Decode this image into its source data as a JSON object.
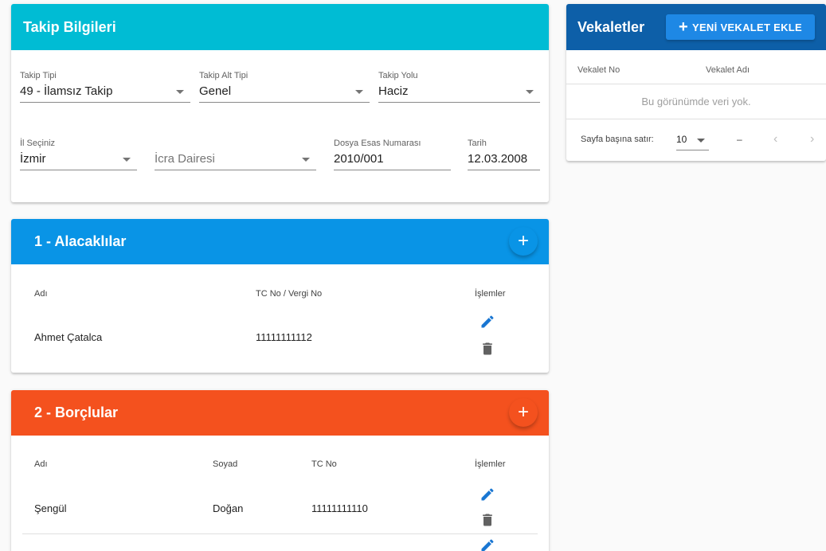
{
  "takip": {
    "title": "Takip Bilgileri",
    "takip_tipi": {
      "label": "Takip Tipi",
      "value": "49 - İlamsız Takip"
    },
    "takip_alt_tipi": {
      "label": "Takip Alt Tipi",
      "value": "Genel"
    },
    "takip_yolu": {
      "label": "Takip Yolu",
      "value": "Haciz"
    },
    "il": {
      "label": "İl Seçiniz",
      "value": "İzmir"
    },
    "icra_dairesi": {
      "placeholder": "İcra Dairesi"
    },
    "dosya_esas": {
      "label": "Dosya Esas Numarası",
      "value": "2010/001"
    },
    "tarih": {
      "label": "Tarih",
      "value": "12.03.2008"
    }
  },
  "alacaklilar": {
    "title": "1 - Alacaklılar",
    "add_icon": "+",
    "columns": [
      "Adı",
      "TC No / Vergi No",
      "İşlemler"
    ],
    "rows": [
      {
        "adi": "Ahmet Çatalca",
        "tc": "11111111112"
      }
    ]
  },
  "borclular": {
    "title": "2 - Borçlular",
    "add_icon": "+",
    "columns": [
      "Adı",
      "Soyad",
      "TC No",
      "İşlemler"
    ],
    "rows": [
      {
        "adi": "Şengül",
        "soyad": "Doğan",
        "tc": "11111111110"
      }
    ]
  },
  "vekaletler": {
    "title": "Vekaletler",
    "add_button": "YENİ VEKALET EKLE",
    "columns": [
      "Vekalet No",
      "Vekalet Adı"
    ],
    "empty_text": "Bu görünümde veri yok.",
    "rows_per_page_label": "Sayfa başına satır:",
    "rows_per_page_value": "10",
    "range_text": "–",
    "prev_icon": "‹",
    "next_icon": "›"
  },
  "colors": {
    "takip_header": "#00bcd4",
    "alacak_header": "#0994e6",
    "borclu_header": "#f4511e",
    "vekalet_header": "#0d5fa8",
    "edit_icon": "#1976d2",
    "delete_icon": "#616161"
  }
}
